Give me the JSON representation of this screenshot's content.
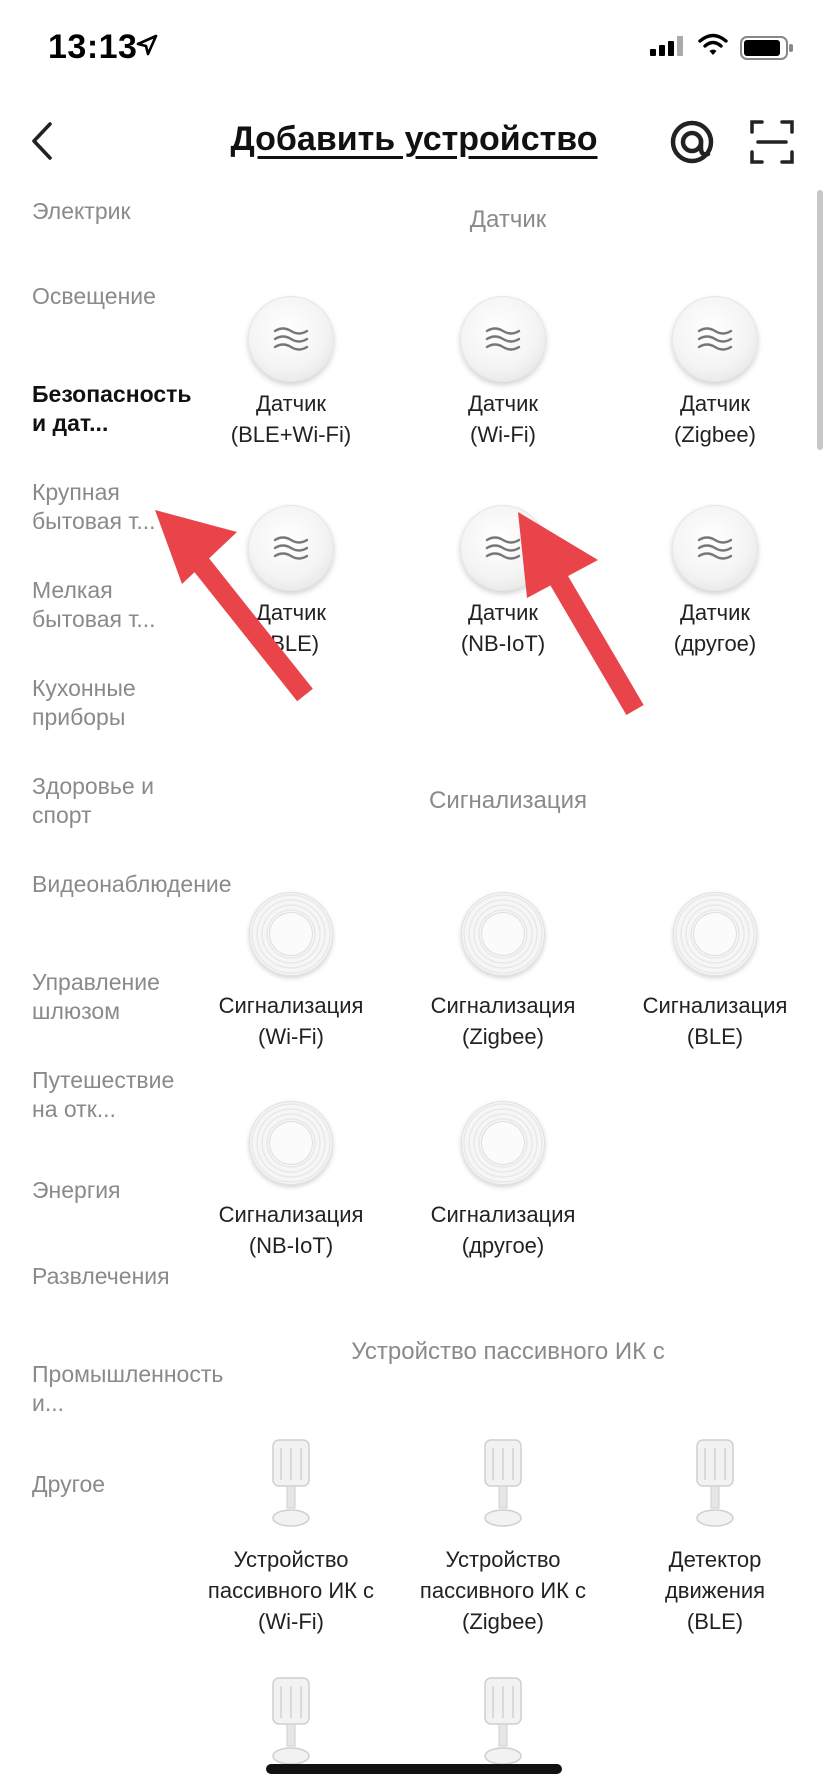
{
  "status": {
    "time": "13:13"
  },
  "nav": {
    "title": "Добавить устройство"
  },
  "categories": [
    "Электрик",
    "Освещение",
    "Безопасность и дат...",
    "Крупная бытовая т...",
    "Мелкая бытовая т...",
    "Кухонные приборы",
    "Здоровье и спорт",
    "Видеонаблюдение",
    "Управление шлюзом",
    "Путешествие на отк...",
    "Энергия",
    "Развлечения",
    "Промышленность и...",
    "Другое"
  ],
  "sections": {
    "sensor": "Датчик",
    "alarm": "Сигнализация",
    "pir": "Устройство пассивного ИК с"
  },
  "sensors": [
    {
      "line1": "Датчик",
      "line2": "(BLE+Wi-Fi)"
    },
    {
      "line1": "Датчик",
      "line2": "(Wi-Fi)"
    },
    {
      "line1": "Датчик",
      "line2": "(Zigbee)"
    },
    {
      "line1": "Датчик",
      "line2": "(BLE)"
    },
    {
      "line1": "Датчик",
      "line2": "(NB-IoT)"
    },
    {
      "line1": "Датчик",
      "line2": "(другое)"
    }
  ],
  "alarms": [
    {
      "line1": "Сигнализация",
      "line2": "(Wi-Fi)"
    },
    {
      "line1": "Сигнализация",
      "line2": "(Zigbee)"
    },
    {
      "line1": "Сигнализация",
      "line2": "(BLE)"
    },
    {
      "line1": "Сигнализация",
      "line2": "(NB-IoT)"
    },
    {
      "line1": "Сигнализация",
      "line2": "(другое)"
    }
  ],
  "pir_devices": [
    {
      "line1": "Устройство",
      "line2": "пассивного ИК с",
      "line3": "(Wi-Fi)"
    },
    {
      "line1": "Устройство",
      "line2": "пассивного ИК с",
      "line3": "(Zigbee)"
    },
    {
      "line1": "Детектор",
      "line2": "движения",
      "line3": "(BLE)"
    }
  ],
  "colors": {
    "annotation_arrow": "#e8444a",
    "active_text": "#111111",
    "muted_text": "#8a8a8a"
  },
  "icons": [
    "location-arrow-icon",
    "signal-icon",
    "wifi-icon",
    "battery-icon",
    "back-chevron-icon",
    "at-sign-icon",
    "scan-icon",
    "wave-icon",
    "smoke-alarm-icon",
    "pir-sensor-icon"
  ]
}
